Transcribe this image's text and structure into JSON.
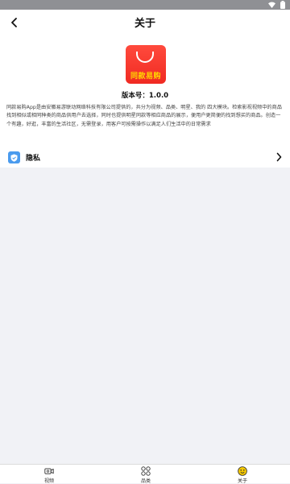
{
  "header": {
    "title": "关于",
    "back_icon": "back-arrow-icon"
  },
  "about": {
    "logo_text": "同款易购",
    "version": "版本号：1.0.0",
    "description": "同款易购App是由安徽易游联动网络科技有限公司提供的，共分为视频、品类、明星、我的 四大模块。检索影视视频中的商品找到相似或相同种类的商品供用户去选择，同时也提供明星同款等相应商品的展示，便用户更简便的找到想买的商品。创造一个有趣，好逛，丰富的生活社区，无需登录，用客户可按需操作以满足人们生活中的日常需求"
  },
  "settings": {
    "privacy_label": "隐私",
    "privacy_icon": "shield-icon",
    "chevron_icon": "chevron-right-icon"
  },
  "tabbar": {
    "items": [
      {
        "label": "视频",
        "icon": "video-camera-icon",
        "active": false
      },
      {
        "label": "品类",
        "icon": "grid-icon",
        "active": false
      },
      {
        "label": "关于",
        "icon": "smiley-face-icon",
        "active": true
      }
    ]
  },
  "colors": {
    "accent": "#f02a22",
    "logo_text": "#ffd800",
    "privacy_icon_bg": "#4a9bee",
    "active_tab": "#f5c800",
    "status_bar": "#8f9094"
  }
}
